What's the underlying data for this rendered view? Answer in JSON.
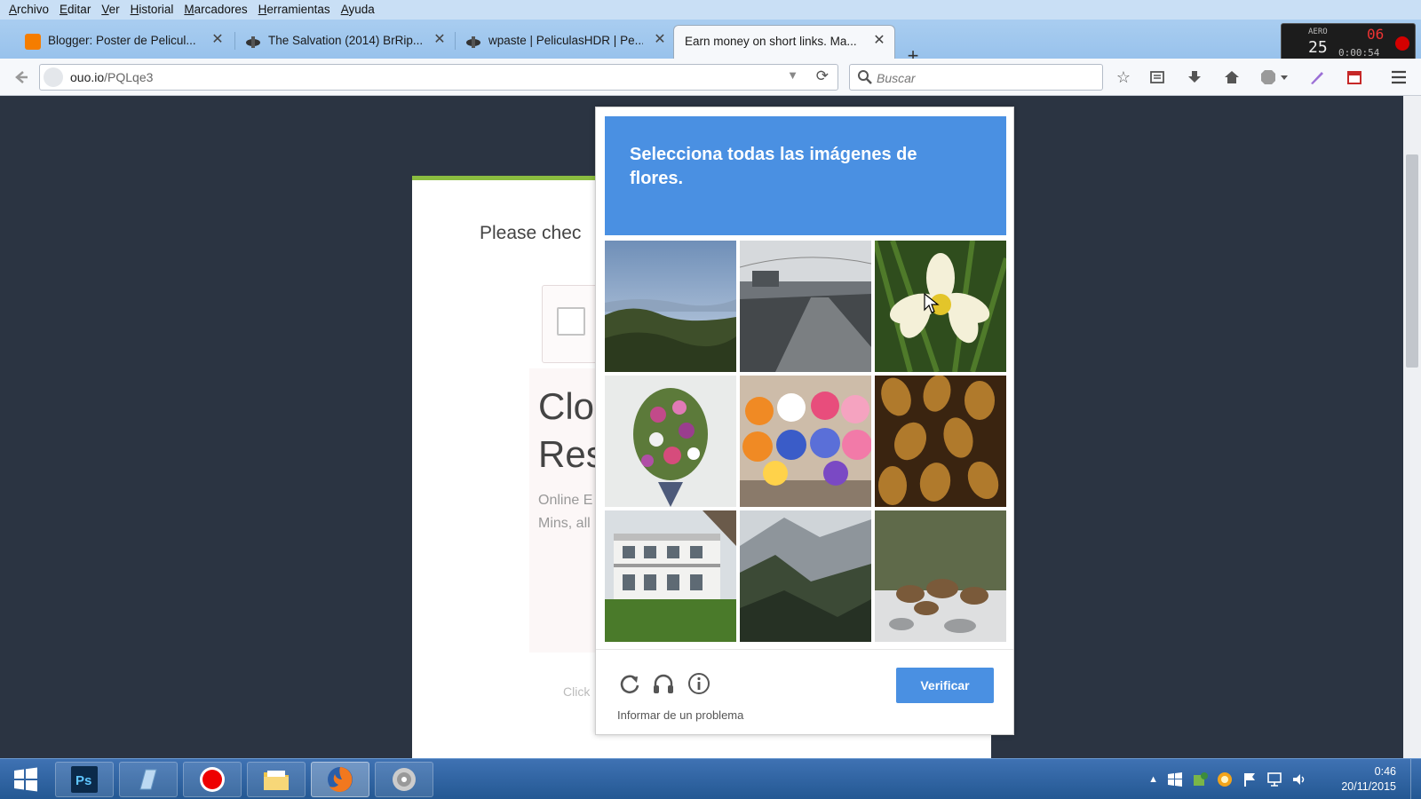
{
  "menubar": {
    "items": [
      "Archivo",
      "Editar",
      "Ver",
      "Historial",
      "Marcadores",
      "Herramientas",
      "Ayuda"
    ]
  },
  "tabs": [
    {
      "label": "Blogger: Poster de Pelicul...",
      "icon": "blogger-icon",
      "color": "#f57d00"
    },
    {
      "label": "The Salvation (2014) BrRip...",
      "icon": "site-favicon",
      "color": "#3a3a3a"
    },
    {
      "label": "wpaste | PeliculasHDR | Pe...",
      "icon": "site-favicon",
      "color": "#3a3a3a"
    },
    {
      "label": "Earn money on short links. Ma...",
      "icon": "none",
      "active": true
    }
  ],
  "recorder": {
    "top_left": "AERO",
    "fps": "25",
    "top_right": "06",
    "timer": "0:00:54"
  },
  "address": {
    "domain": "ouo.io",
    "path": "/PQLqe3"
  },
  "search": {
    "placeholder": "Buscar"
  },
  "page": {
    "title": "Please chec",
    "heading_line1": "Clo",
    "heading_line2": "Res",
    "desc_line1": "Online E",
    "desc_line2": "Mins, all",
    "footer_text": "Click"
  },
  "captcha": {
    "prompt_prefix": "Selecciona todas las imágenes de",
    "prompt_target": "flores",
    "prompt_suffix": ".",
    "tiles": [
      "lake-landscape",
      "canal-reflection",
      "white-flower",
      "flower-bouquet",
      "cupcakes",
      "roasted-snacks",
      "house-lawn",
      "mountain-forest",
      "rocks-snow"
    ],
    "verify_label": "Verificar",
    "report_label": "Informar de un problema",
    "accent": "#4a90e2"
  },
  "taskbar": {
    "apps": [
      "start-button",
      "photoshop",
      "notepad",
      "recorder",
      "file-explorer",
      "firefox",
      "media-player"
    ],
    "time": "0:46",
    "date": "20/11/2015"
  }
}
